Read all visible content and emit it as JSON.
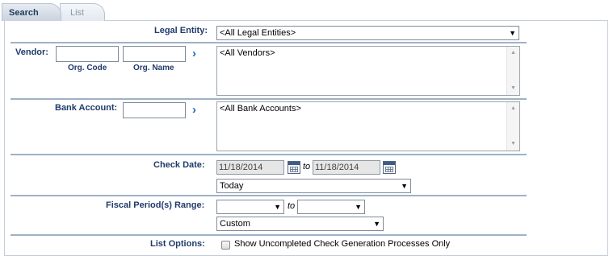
{
  "tabs": [
    {
      "label": "Search",
      "active": true
    },
    {
      "label": "List",
      "active": false
    }
  ],
  "legal_entity": {
    "label": "Legal Entity:",
    "selected": "<All Legal Entities>"
  },
  "vendor": {
    "label": "Vendor:",
    "org_code_label": "Org. Code",
    "org_name_label": "Org. Name",
    "org_code_value": "",
    "org_name_value": "",
    "list_items": [
      "<All Vendors>"
    ]
  },
  "bank_account": {
    "label": "Bank Account:",
    "value": "",
    "list_items": [
      "<All Bank Accounts>"
    ]
  },
  "check_date": {
    "label": "Check Date:",
    "from": "11/18/2014",
    "to_label": "to",
    "to": "11/18/2014",
    "preset": "Today"
  },
  "fiscal_period": {
    "label": "Fiscal Period(s) Range:",
    "from": "",
    "to_label": "to",
    "to": "",
    "preset": "Custom"
  },
  "list_options": {
    "label": "List Options:",
    "checkbox_label": "Show Uncompleted Check Generation Processes Only",
    "checked": false
  },
  "icons": {
    "go": "chevron-right-icon",
    "calendar": "calendar-icon",
    "dropdown": "triangle-down-icon"
  },
  "colors": {
    "label_text": "#1f3b6b",
    "separator": "#9fb1c6",
    "go_arrow": "#1f6bb8"
  }
}
